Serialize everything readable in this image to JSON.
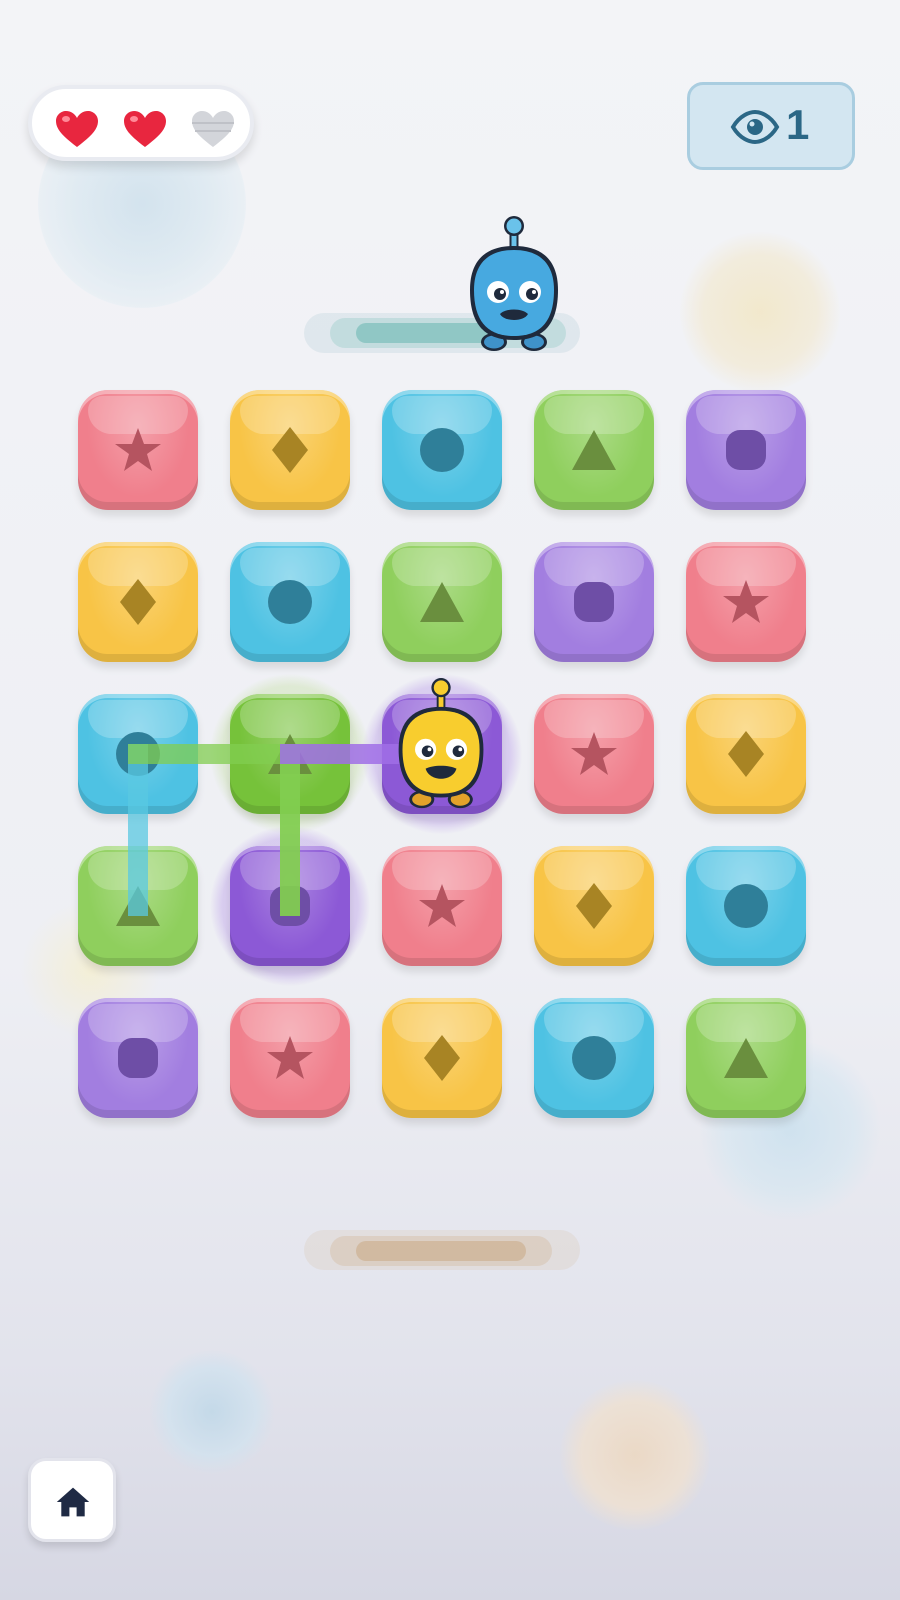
{
  "hud": {
    "lives": {
      "total": 3,
      "remaining": 2,
      "icon": "heart-icon",
      "full_color": "#e8263f",
      "empty_color": "#c9cbd1"
    },
    "hint": {
      "icon": "eye-icon",
      "count": "1"
    }
  },
  "board": {
    "rows": 5,
    "cols": 5,
    "tiles": [
      [
        "red-star",
        "yellow-diamond",
        "blue-circle",
        "green-triangle",
        "purple-square"
      ],
      [
        "yellow-diamond",
        "blue-circle",
        "green-triangle",
        "purple-square",
        "red-star"
      ],
      [
        "blue-circle",
        "green-triangle",
        "purple-square",
        "red-star",
        "yellow-diamond"
      ],
      [
        "green-triangle",
        "purple-square",
        "red-star",
        "yellow-diamond",
        "blue-circle"
      ],
      [
        "purple-square",
        "red-star",
        "yellow-diamond",
        "blue-circle",
        "green-triangle"
      ]
    ],
    "traced_path": [
      [
        3,
        0
      ],
      [
        2,
        0
      ],
      [
        2,
        1
      ],
      [
        3,
        1
      ],
      [
        2,
        1
      ],
      [
        2,
        2
      ]
    ],
    "highlighted_cells": [
      [
        2,
        1
      ],
      [
        2,
        2
      ],
      [
        3,
        1
      ]
    ],
    "player_position": [
      2,
      2
    ],
    "colors": {
      "red": "#f07f8c",
      "yellow": "#f8c446",
      "blue": "#4ec2e3",
      "green": "#8fcf5d",
      "purple": "#a27ee0"
    }
  },
  "characters": {
    "opponent": {
      "name_icon": "blue-robot-icon",
      "color": "#47a9e0"
    },
    "player": {
      "name_icon": "yellow-robot-icon",
      "color": "#f8cd2e"
    }
  },
  "footer": {
    "home_icon": "home-icon"
  }
}
